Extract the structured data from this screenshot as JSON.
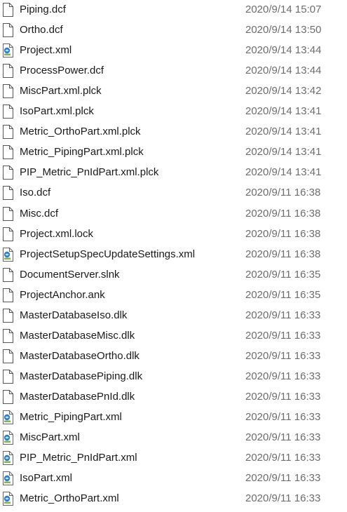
{
  "files": [
    {
      "name": "Piping.dcf",
      "modified": "2020/9/14 15:07",
      "icon": "blank-file-icon"
    },
    {
      "name": "Ortho.dcf",
      "modified": "2020/9/14 13:50",
      "icon": "blank-file-icon"
    },
    {
      "name": "Project.xml",
      "modified": "2020/9/14 13:44",
      "icon": "xml-file-icon"
    },
    {
      "name": "ProcessPower.dcf",
      "modified": "2020/9/14 13:44",
      "icon": "blank-file-icon"
    },
    {
      "name": "MiscPart.xml.plck",
      "modified": "2020/9/14 13:42",
      "icon": "blank-file-icon"
    },
    {
      "name": "IsoPart.xml.plck",
      "modified": "2020/9/14 13:41",
      "icon": "blank-file-icon"
    },
    {
      "name": "Metric_OrthoPart.xml.plck",
      "modified": "2020/9/14 13:41",
      "icon": "blank-file-icon"
    },
    {
      "name": "Metric_PipingPart.xml.plck",
      "modified": "2020/9/14 13:41",
      "icon": "blank-file-icon"
    },
    {
      "name": "PIP_Metric_PnIdPart.xml.plck",
      "modified": "2020/9/14 13:41",
      "icon": "blank-file-icon"
    },
    {
      "name": "Iso.dcf",
      "modified": "2020/9/11 16:38",
      "icon": "blank-file-icon"
    },
    {
      "name": "Misc.dcf",
      "modified": "2020/9/11 16:38",
      "icon": "blank-file-icon"
    },
    {
      "name": "Project.xml.lock",
      "modified": "2020/9/11 16:38",
      "icon": "blank-file-icon"
    },
    {
      "name": "ProjectSetupSpecUpdateSettings.xml",
      "modified": "2020/9/11 16:38",
      "icon": "xml-file-icon"
    },
    {
      "name": "DocumentServer.slnk",
      "modified": "2020/9/11 16:35",
      "icon": "blank-file-icon"
    },
    {
      "name": "ProjectAnchor.ank",
      "modified": "2020/9/11 16:35",
      "icon": "blank-file-icon"
    },
    {
      "name": "MasterDatabaseIso.dlk",
      "modified": "2020/9/11 16:33",
      "icon": "blank-file-icon"
    },
    {
      "name": "MasterDatabaseMisc.dlk",
      "modified": "2020/9/11 16:33",
      "icon": "blank-file-icon"
    },
    {
      "name": "MasterDatabaseOrtho.dlk",
      "modified": "2020/9/11 16:33",
      "icon": "blank-file-icon"
    },
    {
      "name": "MasterDatabasePiping.dlk",
      "modified": "2020/9/11 16:33",
      "icon": "blank-file-icon"
    },
    {
      "name": "MasterDatabasePnId.dlk",
      "modified": "2020/9/11 16:33",
      "icon": "blank-file-icon"
    },
    {
      "name": "Metric_PipingPart.xml",
      "modified": "2020/9/11 16:33",
      "icon": "xml-file-icon"
    },
    {
      "name": "MiscPart.xml",
      "modified": "2020/9/11 16:33",
      "icon": "xml-file-icon"
    },
    {
      "name": "PIP_Metric_PnIdPart.xml",
      "modified": "2020/9/11 16:33",
      "icon": "xml-file-icon"
    },
    {
      "name": "IsoPart.xml",
      "modified": "2020/9/11 16:33",
      "icon": "xml-file-icon"
    },
    {
      "name": "Metric_OrthoPart.xml",
      "modified": "2020/9/11 16:33",
      "icon": "xml-file-icon"
    }
  ],
  "colors": {
    "name_text": "#1a1a1a",
    "date_text": "#6d6d6d",
    "xml_icon_accent": "#2a7fc9"
  }
}
